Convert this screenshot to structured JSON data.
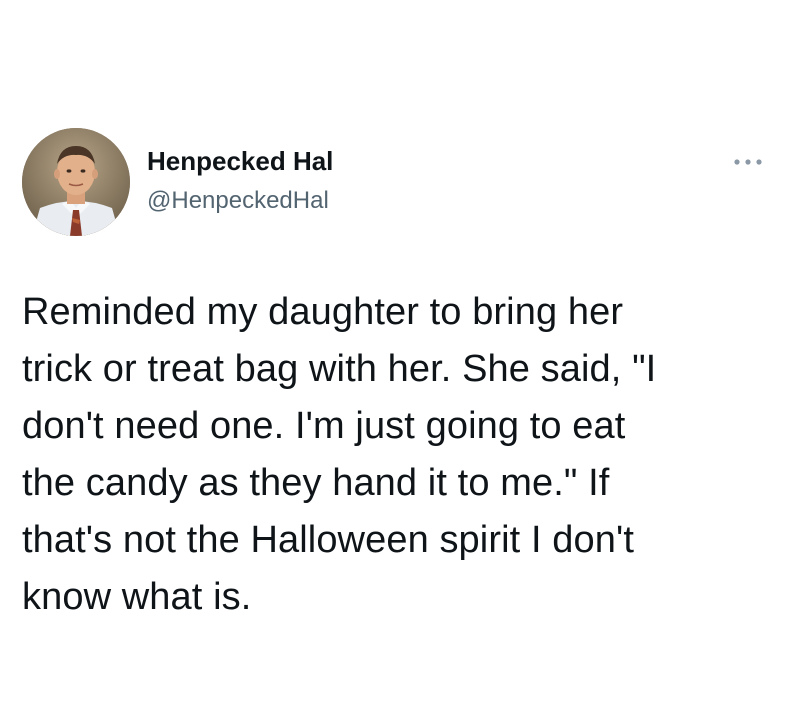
{
  "tweet": {
    "author": {
      "display_name": "Henpecked Hal",
      "handle": "@HenpeckedHal",
      "avatar_icon": "profile-photo"
    },
    "more_icon": "more-options-icon",
    "text": "Reminded my daughter to bring her\ntrick or treat bag with her. She said, \"I\ndon't need one. I'm just going to eat\nthe candy as they hand it to me.\" If\nthat's not the Halloween spirit I don't\nknow what is."
  },
  "colors": {
    "text_primary": "#0f1419",
    "text_secondary": "#536471",
    "background": "#ffffff"
  }
}
